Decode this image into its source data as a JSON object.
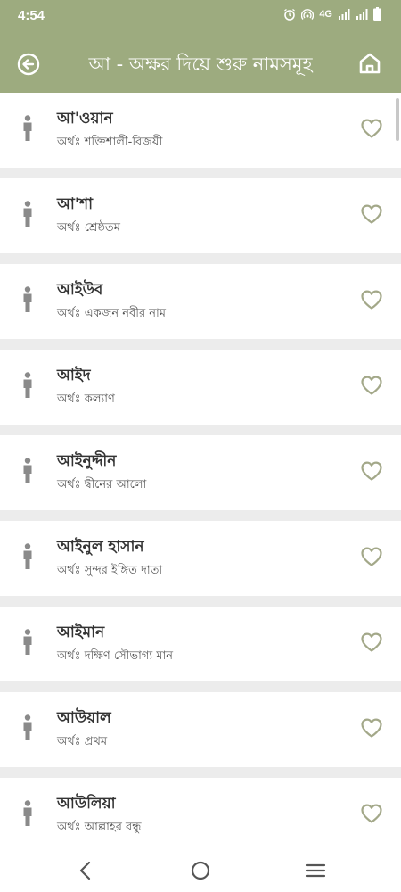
{
  "status_bar": {
    "time": "4:54",
    "network": "4G",
    "icons": [
      "alarm-icon",
      "hotspot-icon",
      "signal-icon",
      "signal-icon",
      "battery-icon"
    ]
  },
  "app_bar": {
    "title": "আ - অক্ষর দিয়ে শুরু নামসমূহ",
    "back_icon": "back-circle-icon",
    "home_icon": "home-icon"
  },
  "colors": {
    "header_bg": "#9dab7f",
    "accent": "#a3a889",
    "list_bg": "#ececec",
    "card_bg": "#ffffff",
    "person_icon": "#8a8a8a"
  },
  "meaning_prefix": "অর্থঃ",
  "names": [
    {
      "name": "আ'ওয়ান",
      "meaning": "শক্তিশালী-বিজয়ী"
    },
    {
      "name": "আ'শা",
      "meaning": "শ্রেষ্ঠতম"
    },
    {
      "name": "আইউব",
      "meaning": "একজন নবীর নাম"
    },
    {
      "name": "আইদ",
      "meaning": "কল্যাণ"
    },
    {
      "name": "আইনুদ্দীন",
      "meaning": "দ্বীনের আলো"
    },
    {
      "name": "আইনুল হাসান",
      "meaning": "সুন্দর ইঙ্গিত দাতা"
    },
    {
      "name": "আইমান",
      "meaning": "দক্ষিণ সৌভাগ্য মান"
    },
    {
      "name": "আউয়াল",
      "meaning": "প্রথম"
    },
    {
      "name": "আউলিয়া",
      "meaning": "আল্লাহর বন্ধু"
    }
  ],
  "nav_bar": {
    "icons": [
      "back-nav-icon",
      "home-nav-icon",
      "recents-nav-icon"
    ]
  }
}
